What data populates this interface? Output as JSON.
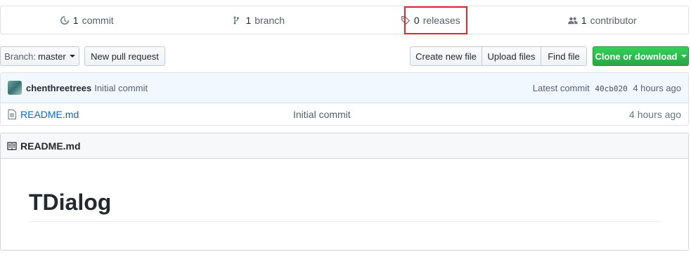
{
  "summary": {
    "commits": {
      "count": "1",
      "label": "commit",
      "icon": "history-icon"
    },
    "branches": {
      "count": "1",
      "label": "branch",
      "icon": "git-branch-icon"
    },
    "releases": {
      "count": "0",
      "label": "releases",
      "icon": "tag-icon"
    },
    "contributors": {
      "count": "1",
      "label": "contributor",
      "icon": "people-icon"
    }
  },
  "toolbar": {
    "branch_prefix": "Branch:",
    "branch_name": "master",
    "new_pull_request": "New pull request",
    "create_new_file": "Create new file",
    "upload_files": "Upload files",
    "find_file": "Find file",
    "clone_or_download": "Clone or download"
  },
  "commit_tease": {
    "author": "chenthreetrees",
    "message": "Initial commit",
    "latest_label": "Latest commit",
    "sha": "40cb020",
    "age": "4 hours ago"
  },
  "files": [
    {
      "name": "README.md",
      "message": "Initial commit",
      "age": "4 hours ago"
    }
  ],
  "readme": {
    "filename": "README.md",
    "heading": "TDialog"
  },
  "colors": {
    "link": "#0366d6",
    "clone_button": "#28a745",
    "highlight": "#e3262c"
  }
}
